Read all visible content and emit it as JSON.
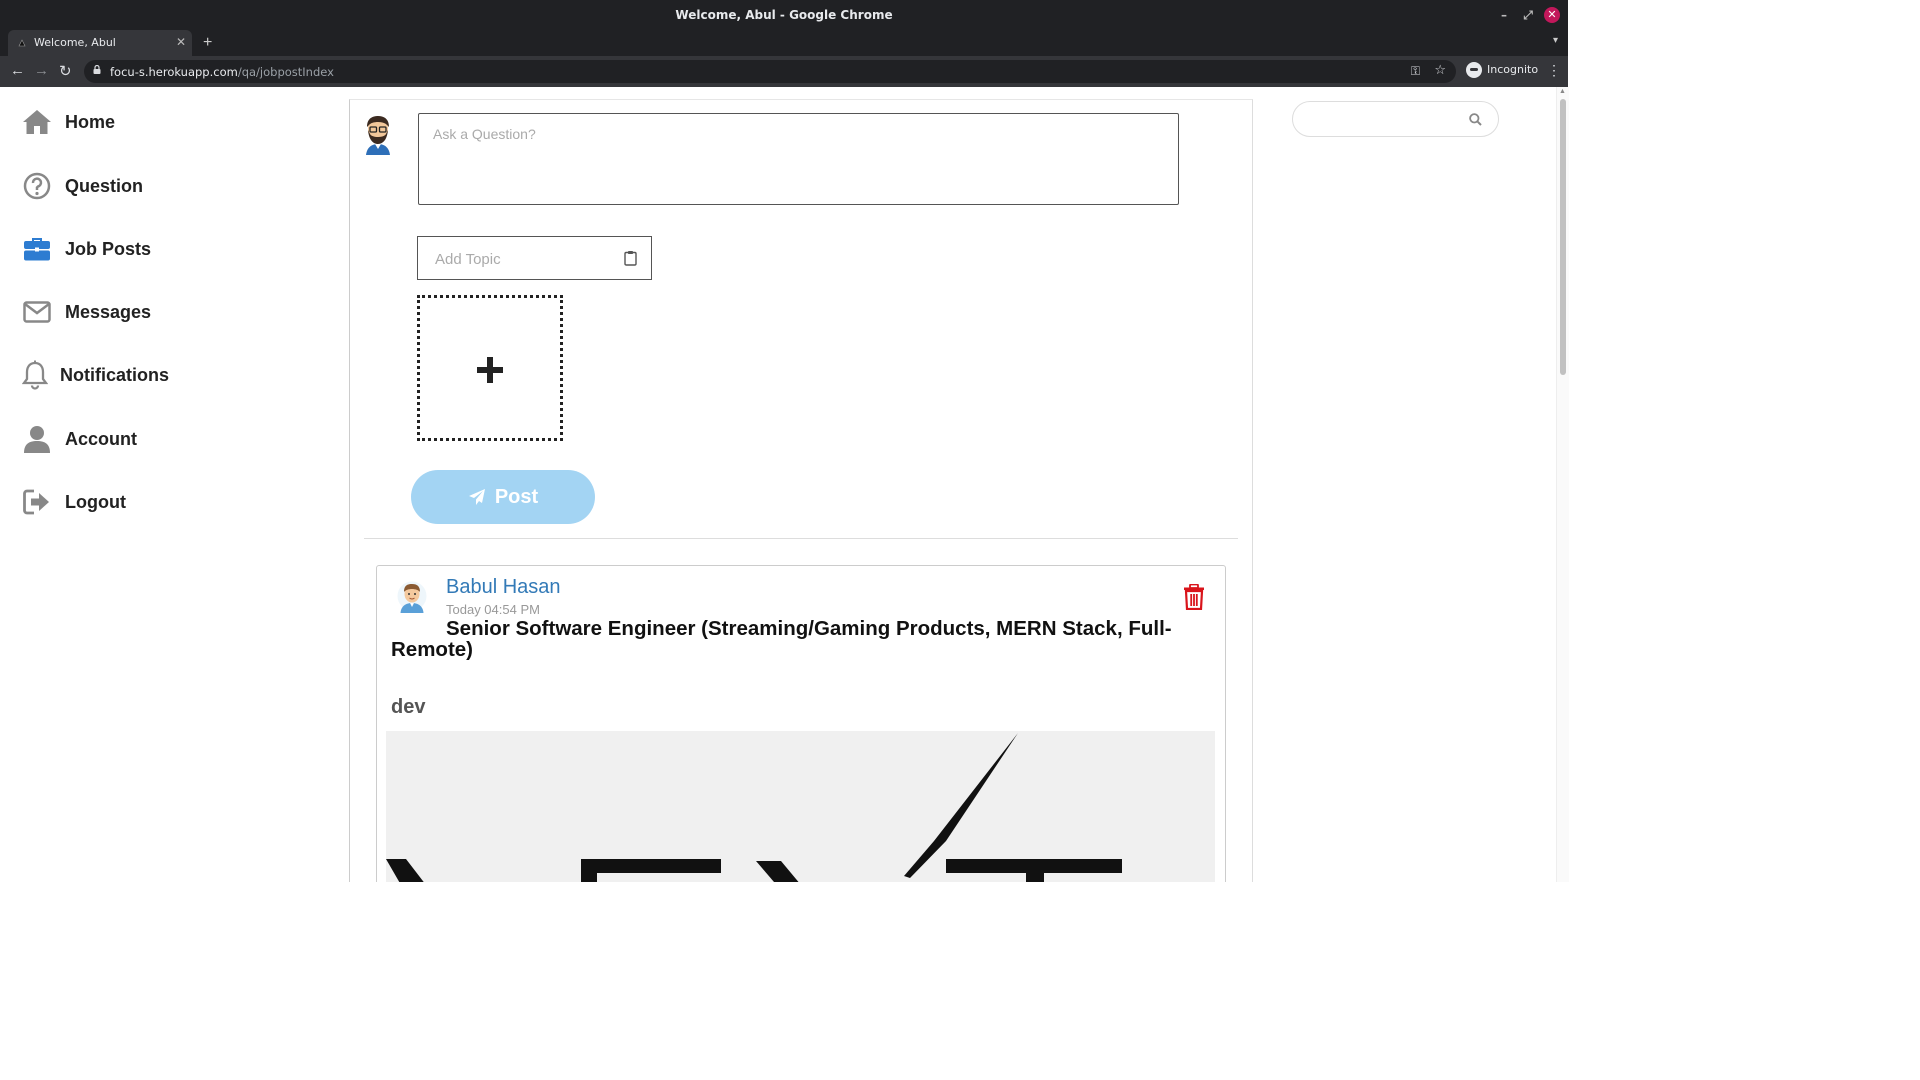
{
  "window": {
    "title": "Welcome, Abul - Google Chrome",
    "tab_label": "Welcome, Abul",
    "url_host": "focu-s.herokuapp.com",
    "url_path": "/qa/jobpostIndex",
    "profile_label": "Incognito"
  },
  "sidebar": {
    "items": [
      {
        "label": "Home",
        "icon": "home-icon"
      },
      {
        "label": "Question",
        "icon": "question-circle-icon"
      },
      {
        "label": "Job Posts",
        "icon": "briefcase-icon",
        "active": true
      },
      {
        "label": "Messages",
        "icon": "envelope-icon"
      },
      {
        "label": "Notifications",
        "icon": "bell-icon"
      },
      {
        "label": "Account",
        "icon": "user-icon"
      },
      {
        "label": "Logout",
        "icon": "sign-out-icon"
      }
    ],
    "active_color": "#2d7cd1"
  },
  "composer": {
    "question_placeholder": "Ask a Question?",
    "topic_placeholder": "Add Topic",
    "post_label": "Post",
    "post_button_color": "#a3d4f3"
  },
  "feed": {
    "posts": [
      {
        "author": "Babul Hasan",
        "time": "Today 04:54 PM",
        "title": "Senior Software Engineer (Streaming/Gaming Products, MERN Stack, Full-Remote)",
        "topic": "dev",
        "author_color": "#337ab7",
        "delete_color": "#d9141b"
      }
    ]
  },
  "search": {
    "placeholder": ""
  }
}
